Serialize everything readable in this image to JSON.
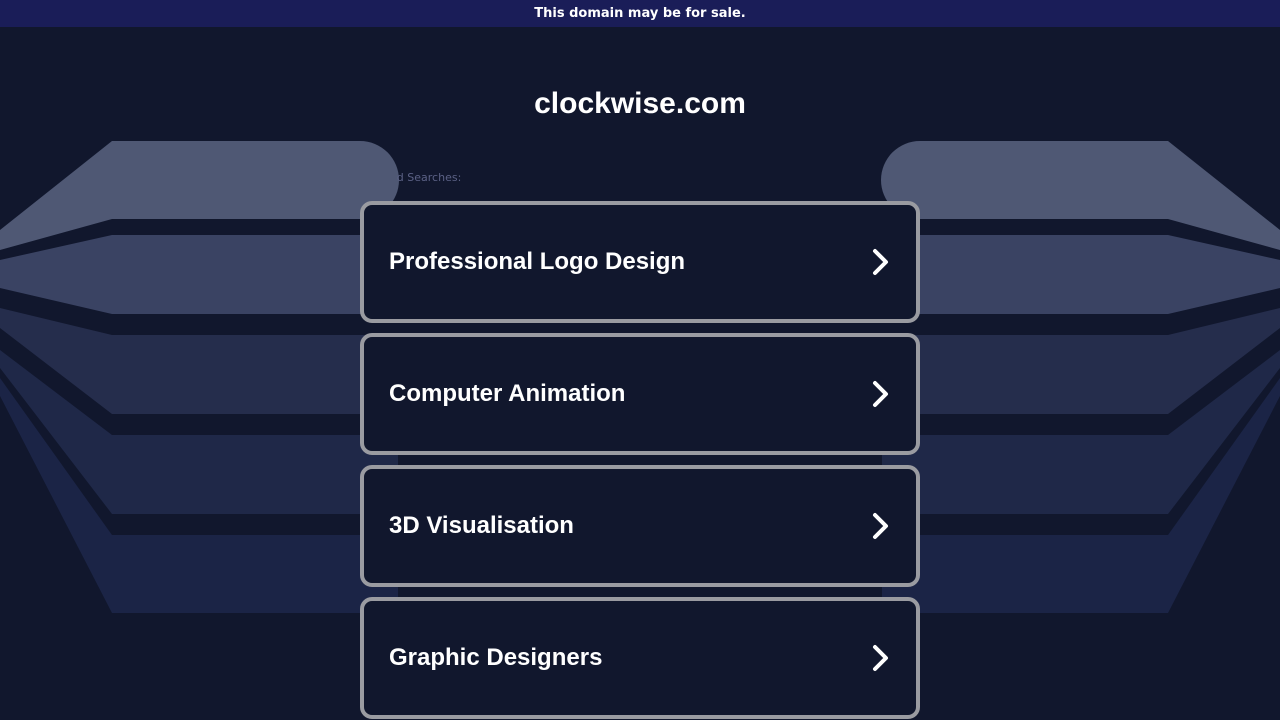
{
  "banner": {
    "text": "This domain may be for sale."
  },
  "domain": {
    "name": "clockwise.com"
  },
  "related": {
    "label": "Related Searches:",
    "visible_label": "d Searches:",
    "items": [
      {
        "label": "Professional Logo Design"
      },
      {
        "label": "Computer Animation"
      },
      {
        "label": "3D Visualisation"
      },
      {
        "label": "Graphic Designers"
      }
    ]
  },
  "icons": {
    "link_arrow": "chevron-right-icon"
  },
  "colors": {
    "background": "#11172d",
    "banner": "#1a1d58",
    "card_border": "#9a9ba1",
    "text": "#ffffff",
    "muted_text": "#5b6185"
  }
}
